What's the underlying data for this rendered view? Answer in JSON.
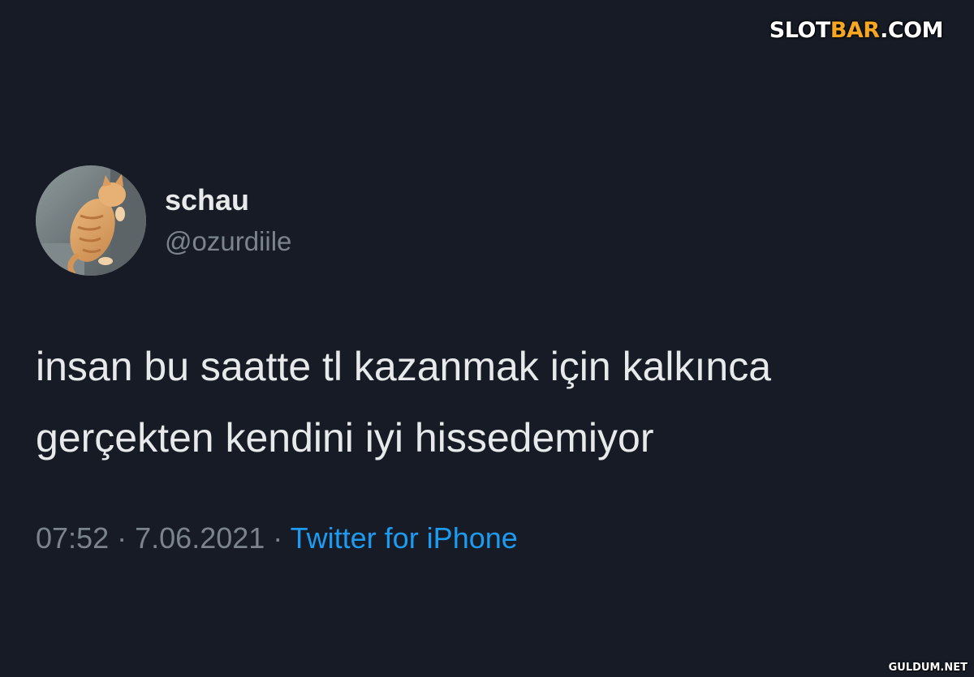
{
  "watermark": {
    "brand_prefix": "SLOT",
    "brand_accent": "BAR",
    "brand_suffix": ".COM",
    "bottom": "GULDUM.NET"
  },
  "tweet": {
    "author": {
      "display_name": "schau",
      "handle": "@ozurdiile",
      "avatar": "cat-photo"
    },
    "text_lines": [
      "insan bu saatte tl kazanmak için kalkınca",
      "gerçekten kendini iyi hissedemiyor"
    ],
    "time": "07:52",
    "separator": "·",
    "date": "7.06.2021",
    "source": "Twitter for iPhone"
  },
  "colors": {
    "background": "#161b25",
    "text_primary": "#e7e9ea",
    "text_secondary": "#7b848d",
    "link": "#1d9bf0",
    "watermark_accent": "#f5a623"
  }
}
